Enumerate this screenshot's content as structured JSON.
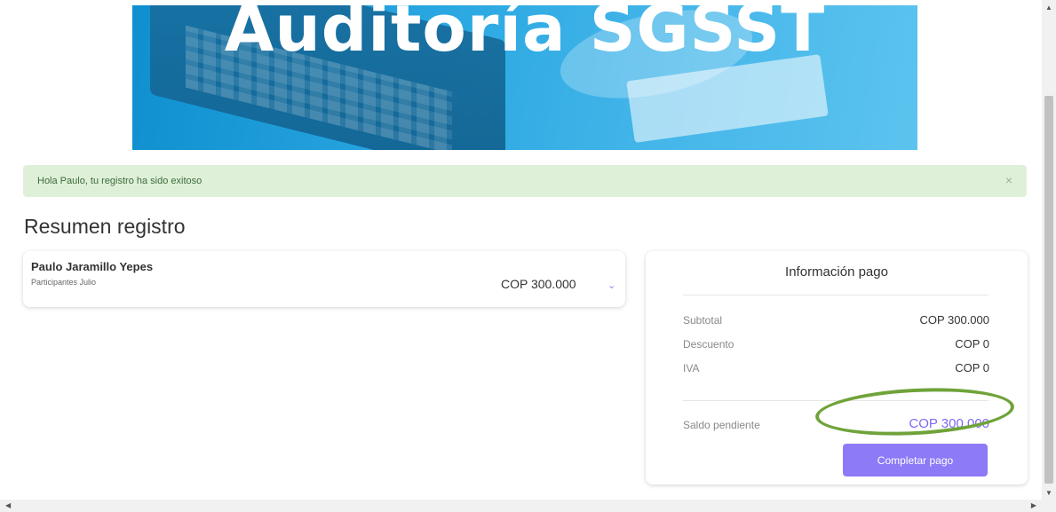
{
  "banner": {
    "title": "Auditoría SGSST"
  },
  "alert": {
    "message": "Hola Paulo, tu registro ha sido exitoso",
    "close": "×"
  },
  "summary": {
    "heading": "Resumen registro"
  },
  "registrant": {
    "name": "Paulo Jaramillo Yepes",
    "group": "Participantes Julio",
    "price": "COP 300.000",
    "chevron": "⌄"
  },
  "payment": {
    "title": "Información pago",
    "subtotal_label": "Subtotal",
    "subtotal_value": "COP 300.000",
    "discount_label": "Descuento",
    "discount_value": "COP 0",
    "tax_label": "IVA",
    "tax_value": "COP 0",
    "pending_label": "Saldo pendiente",
    "pending_value": "COP 300.000",
    "button_label": "Completar pago"
  },
  "colors": {
    "accent": "#8c7af7",
    "alert_bg": "#dff0d8",
    "banner": "#2ba8e2",
    "highlight": "#6fa33a"
  }
}
